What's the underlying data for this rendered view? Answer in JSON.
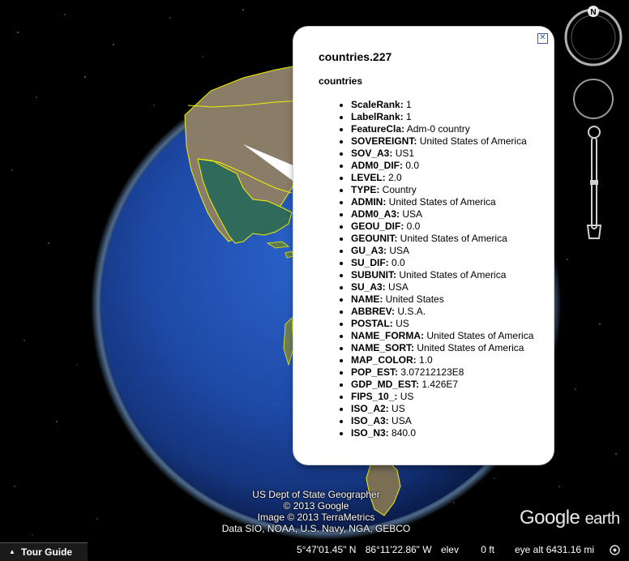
{
  "balloon": {
    "title": "countries.227",
    "subtitle": "countries",
    "close_icon": "close-icon",
    "attributes": [
      {
        "key": "ScaleRank:",
        "value": " 1"
      },
      {
        "key": "LabelRank:",
        "value": " 1"
      },
      {
        "key": "FeatureCla:",
        "value": " Adm-0 country"
      },
      {
        "key": "SOVEREIGNT:",
        "value": " United States of America"
      },
      {
        "key": "SOV_A3:",
        "value": " US1"
      },
      {
        "key": "ADM0_DIF:",
        "value": " 0.0"
      },
      {
        "key": "LEVEL:",
        "value": " 2.0"
      },
      {
        "key": "TYPE:",
        "value": " Country"
      },
      {
        "key": "ADMIN:",
        "value": " United States of America"
      },
      {
        "key": "ADM0_A3:",
        "value": " USA"
      },
      {
        "key": "GEOU_DIF:",
        "value": " 0.0"
      },
      {
        "key": "GEOUNIT:",
        "value": " United States of America"
      },
      {
        "key": "GU_A3:",
        "value": " USA"
      },
      {
        "key": "SU_DIF:",
        "value": " 0.0"
      },
      {
        "key": "SUBUNIT:",
        "value": " United States of America"
      },
      {
        "key": "SU_A3:",
        "value": " USA"
      },
      {
        "key": "NAME:",
        "value": " United States"
      },
      {
        "key": "ABBREV:",
        "value": " U.S.A."
      },
      {
        "key": "POSTAL:",
        "value": " US"
      },
      {
        "key": "NAME_FORMA:",
        "value": " United States of America"
      },
      {
        "key": "NAME_SORT:",
        "value": " United States of America"
      },
      {
        "key": "MAP_COLOR:",
        "value": " 1.0"
      },
      {
        "key": "POP_EST:",
        "value": " 3.07212123E8"
      },
      {
        "key": "GDP_MD_EST:",
        "value": " 1.426E7"
      },
      {
        "key": "FIPS_10_:",
        "value": " US"
      },
      {
        "key": "ISO_A2:",
        "value": " US"
      },
      {
        "key": "ISO_A3:",
        "value": " USA"
      },
      {
        "key": "ISO_N3:",
        "value": " 840.0"
      }
    ]
  },
  "navigation": {
    "compass_label": "N",
    "icons": [
      "compass-icon",
      "look-joystick-icon",
      "zoom-slider-icon"
    ]
  },
  "attribution": {
    "line1": "US Dept of State Geographer",
    "line2": "© 2013 Google",
    "line3": "Image © 2013 TerraMetrics",
    "line4": "Data SIO, NOAA, U.S. Navy, NGA, GEBCO"
  },
  "logo": {
    "google": "Google",
    "earth": "earth"
  },
  "tour_guide": {
    "label": "Tour Guide",
    "icon": "triangle-up-icon"
  },
  "status": {
    "latitude": "5°47'01.45\" N",
    "longitude": "86°11'22.86\" W",
    "elev_label": "elev",
    "elev_value": "0 ft",
    "eye_alt": "eye alt 6431.16 mi",
    "stream_icon": "streaming-icon"
  },
  "colors": {
    "ocean": "#1f4fb0",
    "land_dry": "#8a7d68",
    "land_green": "#2f6a5a",
    "border": "#f2f200",
    "balloon_bg": "#ffffff"
  }
}
